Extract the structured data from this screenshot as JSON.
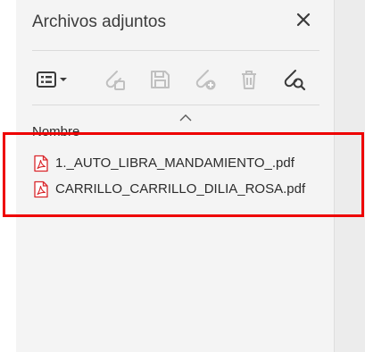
{
  "panel": {
    "title": "Archivos adjuntos",
    "column_header": "Nombre"
  },
  "toolbar": {
    "icons": [
      "list-view-icon",
      "dropdown-icon",
      "attach-icon",
      "save-icon",
      "add-attachment-icon",
      "delete-icon",
      "search-attachment-icon"
    ]
  },
  "attachments": [
    {
      "name": "1._AUTO_LIBRA_MANDAMIENTO_.pdf",
      "icon": "pdf-icon"
    },
    {
      "name": "CARRILLO_CARRILLO_DILIA_ROSA.pdf",
      "icon": "pdf-icon"
    }
  ],
  "colors": {
    "highlight": "#ee0000",
    "pdf_icon": "#d9262b",
    "panel_bg": "#f4f4f4"
  }
}
